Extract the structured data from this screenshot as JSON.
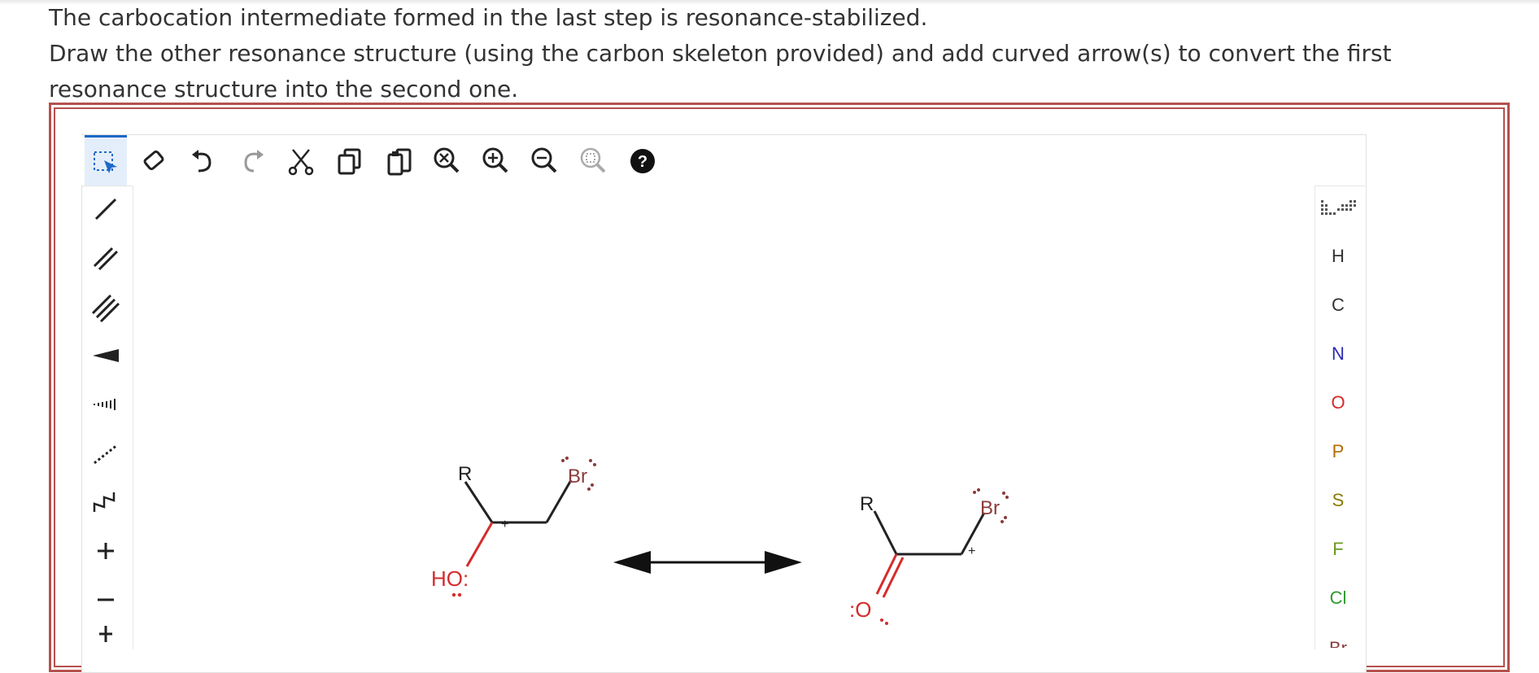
{
  "question": {
    "line1": "The carbocation intermediate formed in the last step is resonance-stabilized.",
    "line2": "Draw the other resonance structure (using the carbon skeleton provided) and add curved arrow(s) to convert the first resonance structure into the second one."
  },
  "toolbar": {
    "tools": [
      {
        "name": "select-icon"
      },
      {
        "name": "erase-icon"
      },
      {
        "name": "undo-icon"
      },
      {
        "name": "redo-icon"
      },
      {
        "name": "cut-icon"
      },
      {
        "name": "copy-icon"
      },
      {
        "name": "paste-icon"
      },
      {
        "name": "zoom-reset-icon"
      },
      {
        "name": "zoom-in-icon"
      },
      {
        "name": "zoom-out-icon"
      },
      {
        "name": "zoom-fit-icon"
      },
      {
        "name": "help-icon"
      }
    ]
  },
  "left_tools": [
    {
      "name": "single-bond-icon"
    },
    {
      "name": "double-bond-icon"
    },
    {
      "name": "triple-bond-icon"
    },
    {
      "name": "wedge-bond-icon"
    },
    {
      "name": "hash-bond-icon"
    },
    {
      "name": "dashed-bond-icon"
    },
    {
      "name": "chain-icon"
    },
    {
      "name": "positive-charge-icon"
    },
    {
      "name": "negative-charge-icon"
    },
    {
      "name": "radical-icon"
    }
  ],
  "elements": {
    "items": [
      "H",
      "C",
      "N",
      "O",
      "P",
      "S",
      "F",
      "Cl",
      "Br"
    ],
    "colors": {
      "H": "#333333",
      "C": "#333333",
      "N": "#2b2bb5",
      "O": "#d62b2b",
      "P": "#b36a00",
      "S": "#8a7a00",
      "F": "#6a9a1f",
      "Cl": "#2d9a2d",
      "Br": "#8b3a3a"
    }
  },
  "molecules": {
    "left": {
      "r_label": "R",
      "oh_label": "HO:",
      "br_label": "Br",
      "charge": "+"
    },
    "right": {
      "r_label": "R",
      "o_label": ":O",
      "br_label": "Br",
      "charge": "+"
    }
  },
  "colors": {
    "frame": "#b5514d",
    "oxygen": "#d62b2b",
    "bromine": "#8b3a3a",
    "accent": "#1d68c9"
  }
}
